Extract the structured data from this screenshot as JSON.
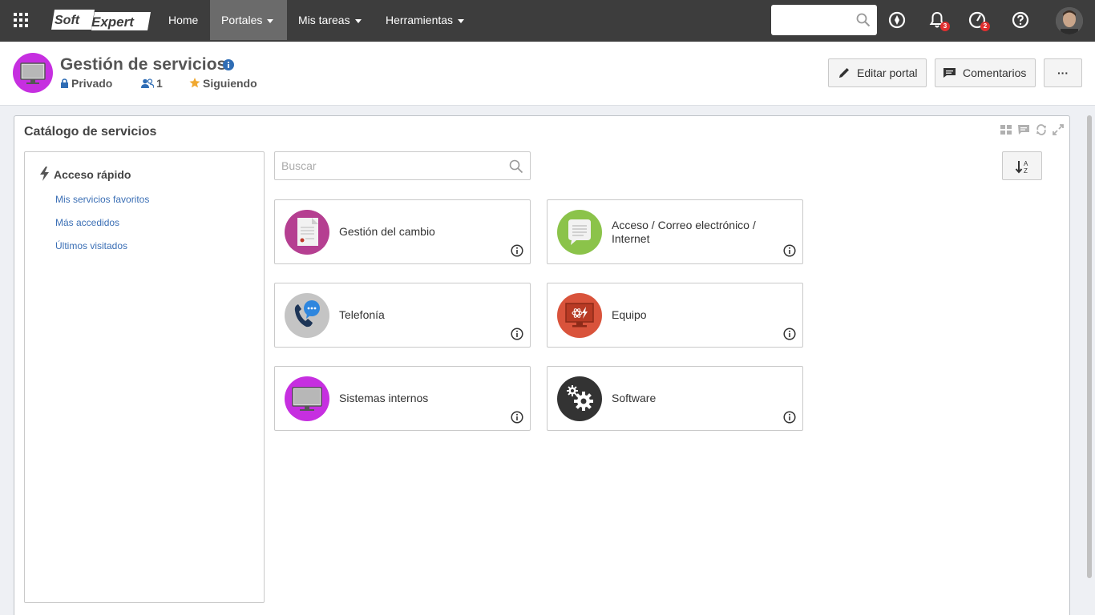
{
  "topbar": {
    "brand": "SoftExpert",
    "nav": [
      {
        "label": "Home",
        "dropdown": false
      },
      {
        "label": "Portales",
        "dropdown": true,
        "active": true
      },
      {
        "label": "Mis tareas",
        "dropdown": true
      },
      {
        "label": "Herramientas",
        "dropdown": true
      }
    ],
    "search_value": "",
    "notifications_badge": "3",
    "tasks_badge": "2"
  },
  "header": {
    "title": "Gestión de servicios",
    "privacy": "Privado",
    "members": "1",
    "follow": "Siguiendo",
    "edit_button": "Editar portal",
    "comments_button": "Comentarios",
    "more_button": "···"
  },
  "widget": {
    "title": "Catálogo de servicios",
    "quick_access": {
      "title": "Acceso rápido",
      "links": [
        "Mis servicios favoritos",
        "Más accedidos",
        "Últimos visitados"
      ]
    },
    "search_placeholder": "Buscar",
    "services": [
      {
        "label": "Gestión del cambio",
        "icon": "document-icon",
        "color": "#b53f91"
      },
      {
        "label": "Acceso / Correo electrónico / Internet",
        "icon": "chat-bubble-icon",
        "color": "#8bc34a"
      },
      {
        "label": "Telefonía",
        "icon": "phone-chat-icon",
        "color": "#c4c4c4"
      },
      {
        "label": "Equipo",
        "icon": "monitor-atom-icon",
        "color": "#d9533b"
      },
      {
        "label": "Sistemas internos",
        "icon": "monitor-icon",
        "color": "#c62fe0"
      },
      {
        "label": "Software",
        "icon": "gears-icon",
        "color": "#333333"
      }
    ]
  },
  "colors": {
    "topbar": "#3d3d3d",
    "active_nav": "#6b6b6b",
    "link": "#3b6fb5",
    "badge": "#e02f2f"
  }
}
